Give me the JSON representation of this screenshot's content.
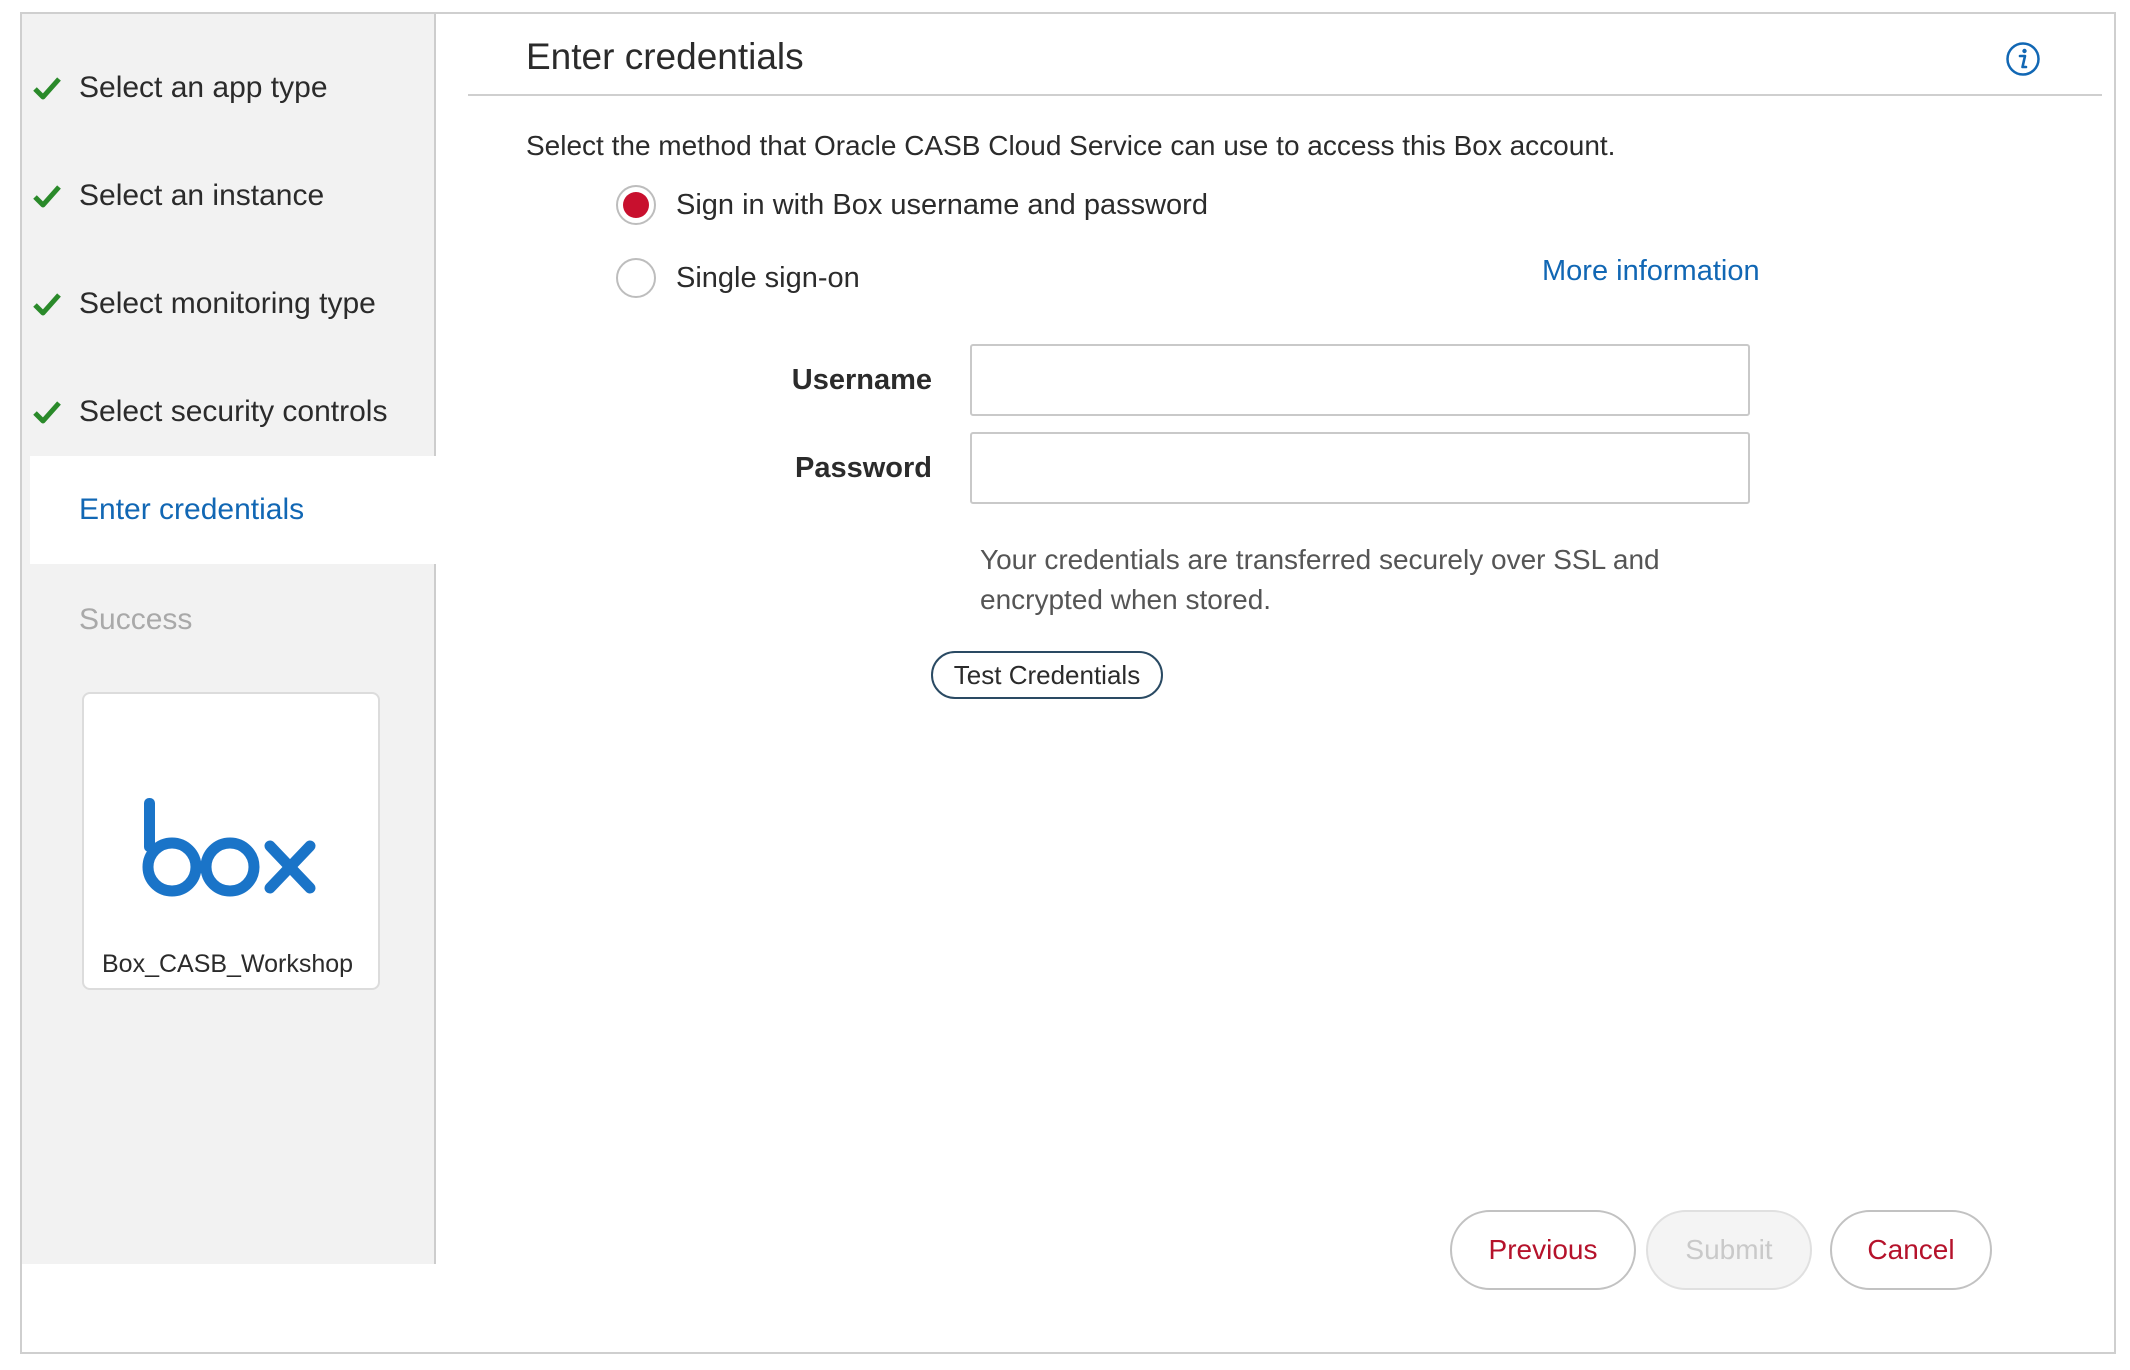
{
  "sidebar": {
    "steps": [
      {
        "label": "Select an app type",
        "state": "completed"
      },
      {
        "label": "Select an instance",
        "state": "completed"
      },
      {
        "label": "Select monitoring type",
        "state": "completed"
      },
      {
        "label": "Select security controls",
        "state": "completed"
      },
      {
        "label": "Enter credentials",
        "state": "active"
      },
      {
        "label": "Success",
        "state": "disabled"
      }
    ],
    "app_card": {
      "logo_icon": "box-logo",
      "name": "Box_CASB_Workshop"
    }
  },
  "main": {
    "title": "Enter credentials",
    "info_icon": "info-icon",
    "instruction": "Select the method that Oracle CASB Cloud Service can use to access this Box account.",
    "methods": [
      {
        "label": "Sign in with Box username and password",
        "selected": true
      },
      {
        "label": "Single sign-on",
        "selected": false
      }
    ],
    "more_info_link": "More information",
    "fields": {
      "username_label": "Username",
      "username_value": "",
      "password_label": "Password",
      "password_value": ""
    },
    "note": "Your credentials are transferred securely over SSL and encrypted when stored.",
    "test_button": "Test Credentials"
  },
  "footer": {
    "previous": "Previous",
    "submit": "Submit",
    "submit_enabled": false,
    "cancel": "Cancel"
  },
  "colors": {
    "accent_link": "#1167b4",
    "check_green": "#2a8a2a",
    "radio_selected": "#c8102e",
    "button_text": "#b5122b",
    "box_brand": "#1a74c8"
  }
}
